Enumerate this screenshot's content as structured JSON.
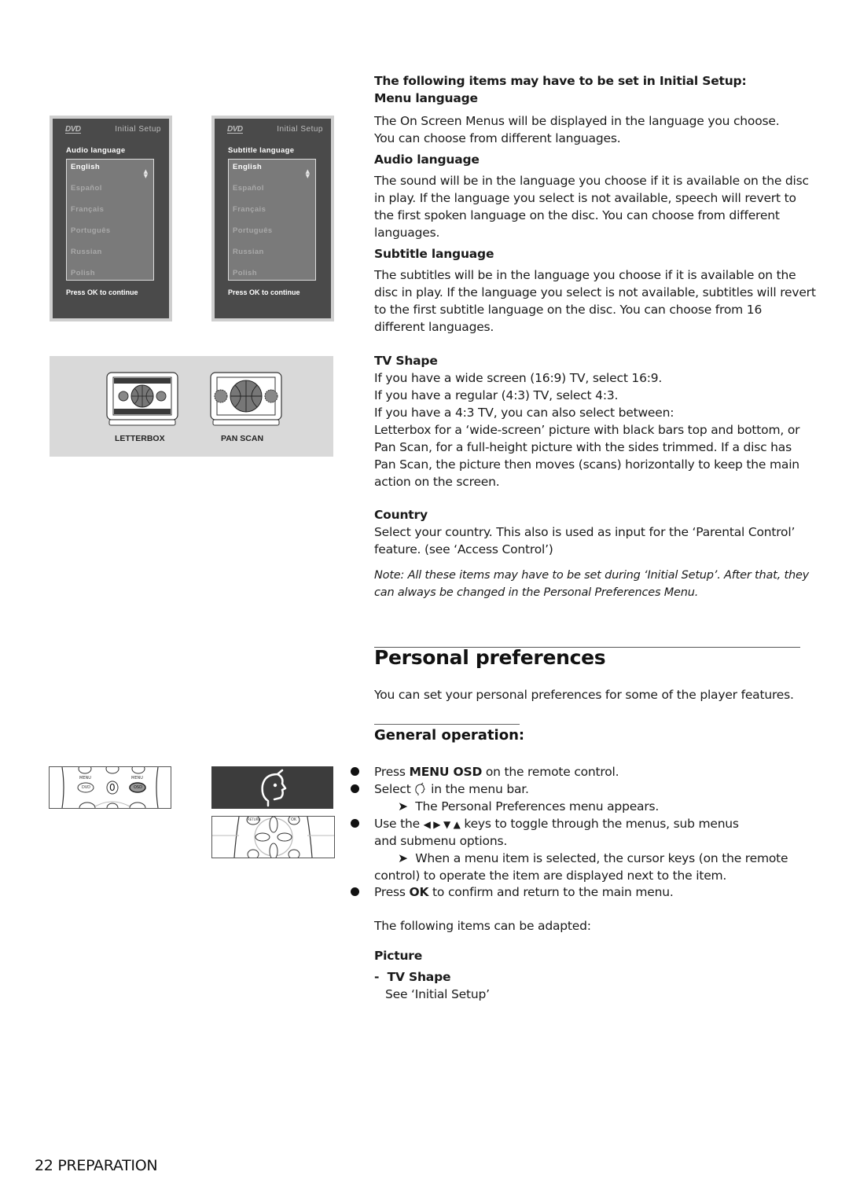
{
  "osd_screens": [
    {
      "logo": "DVD",
      "title": "Initial Setup",
      "label": "Audio language",
      "items": [
        "English",
        "Español",
        "Français",
        "Português",
        "Russian",
        "Polish"
      ],
      "selected": "English",
      "footer": "Press OK to continue"
    },
    {
      "logo": "DVD",
      "title": "Initial Setup",
      "label": "Subtitle language",
      "items": [
        "English",
        "Español",
        "Français",
        "Português",
        "Russian",
        "Polish"
      ],
      "selected": "English",
      "footer": "Press OK to continue"
    }
  ],
  "tv_illustration": {
    "captions": [
      "LETTERBOX",
      "PAN SCAN"
    ]
  },
  "remote_labels": {
    "menu_left": "MENU",
    "menu_right": "MENU",
    "dvd_button": "DVD",
    "osd_button": "OSD",
    "zero_button": "0",
    "return_button": "RETURN",
    "ok_button": "OK"
  },
  "initial_setup": {
    "intro": "The following items may have to be set in Initial Setup:",
    "sections": [
      {
        "heading": "Menu language",
        "lines": [
          "The On Screen Menus will be displayed in the language you choose.",
          "You can choose from different languages."
        ]
      },
      {
        "heading": "Audio language",
        "lines": [
          "The sound will be in the language you choose if it is available on the disc",
          "in play. If the language you select is not available, speech will revert to",
          "the first spoken language on the disc. You can choose from different",
          "languages."
        ]
      },
      {
        "heading": "Subtitle language",
        "lines": [
          "The subtitles will be in the language you choose if it is available on the",
          "disc in play. If the language you select is not available, subtitles will revert",
          "to the first subtitle language on the disc. You can choose from 16",
          "different languages."
        ]
      },
      {
        "heading": "TV Shape",
        "lines": [
          "If you have a wide screen (16:9) TV, select 16:9.",
          "If you have a regular  (4:3) TV, select 4:3.",
          "If you have a 4:3 TV, you can also select between:",
          "Letterbox for a ‘wide-screen’ picture with black bars top and bottom, or",
          "Pan Scan, for a full-height picture with the sides trimmed. If a disc has",
          "Pan Scan, the picture then moves (scans) horizontally to keep the main",
          "action on the screen."
        ]
      },
      {
        "heading": "Country",
        "lines": [
          "Select your country. This also is used as input for the ‘Parental Control’",
          "feature. (see ‘Access Control’)"
        ]
      }
    ],
    "note_lines": [
      "Note:  All these items may have to be set during ‘Initial Setup’.  After that, they",
      "can always be changed in the Personal Preferences Menu."
    ]
  },
  "personal_preferences": {
    "title": "Personal preferences",
    "intro": "You can set your personal preferences for some of the player features.",
    "general_heading": "General operation:",
    "steps": {
      "s1_pre": "Press ",
      "s1_bold": "MENU OSD",
      "s1_post": " on the remote control.",
      "s2_pre": "Select ",
      "s2_post": " in the menu bar.",
      "s2_result": "The Personal Preferences menu appears.",
      "s3_pre": "Use the ",
      "s3_keys": "◀ ▶ ▼ ▲",
      "s3_post": " keys to toggle through the menus, sub menus",
      "s3_line2": "and submenu options.",
      "s3_result_l1": "When a menu item is selected, the cursor keys (on the remote",
      "s3_result_l2": "control) to operate the item are displayed next to the item.",
      "s4_pre": "Press ",
      "s4_bold": "OK",
      "s4_post": " to confirm and return to the main menu."
    },
    "adapted_intro": "The following items can be adapted:",
    "picture_heading": "Picture",
    "tv_shape_item": "TV Shape",
    "tv_shape_desc": "See ‘Initial Setup’"
  },
  "footer": {
    "page_number": "22",
    "section": "PREPARATION"
  }
}
